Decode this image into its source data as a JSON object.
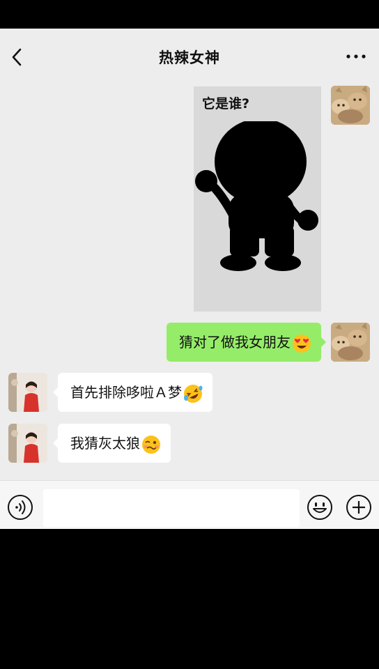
{
  "header": {
    "title": "热辣女神",
    "back_icon": "chevron-left-icon",
    "more_icon": "ellipsis-icon"
  },
  "messages": [
    {
      "side": "right",
      "type": "image",
      "caption": "它是谁?"
    },
    {
      "side": "right",
      "type": "text",
      "text": "猜对了做我女朋友",
      "emoji": "heart-eyes-emoji"
    },
    {
      "side": "left",
      "type": "text",
      "text": "首先排除哆啦Ａ梦",
      "emoji": "rolling-laughing-emoji"
    },
    {
      "side": "left",
      "type": "text",
      "text": "我猜灰太狼",
      "emoji": "woozy-face-emoji"
    }
  ],
  "composer": {
    "voice_icon": "voice-icon",
    "emoji_icon": "smiley-icon",
    "plus_icon": "plus-icon",
    "input_value": ""
  },
  "colors": {
    "chat_bg": "#ededed",
    "my_bubble": "#95ec69",
    "their_bubble": "#ffffff",
    "image_bg": "#d9d9d9"
  }
}
